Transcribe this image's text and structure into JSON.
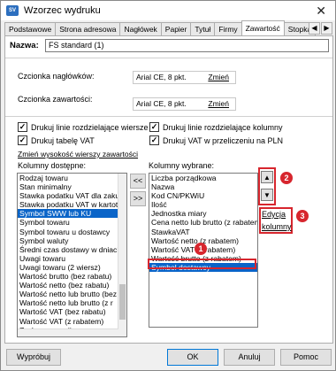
{
  "window": {
    "app_icon": "SV",
    "title": "Wzorzec wydruku",
    "close_glyph": "✕"
  },
  "tabs": [
    "Podstawowe",
    "Strona adresowa",
    "Nagłówek",
    "Papier",
    "Tytuł",
    "Firmy",
    "Zawartość",
    "Stopka"
  ],
  "active_tab": "Zawartość",
  "tab_scroll": {
    "left": "◀",
    "right": "▶"
  },
  "name": {
    "label": "Nazwa:",
    "value": "FS standard (1)"
  },
  "fonts": {
    "header_label": "Czcionka nagłówków:",
    "header_value": "Arial CE, 8 pkt.",
    "header_change": "Zmień",
    "content_label": "Czcionka zawartości:",
    "content_value": "Arial CE, 8 pkt.",
    "content_change": "Zmień"
  },
  "checkboxes": {
    "row_lines": "Drukuj linie rozdzielające wiersze",
    "col_lines": "Drukuj linie rozdzielające kolumny",
    "vat_table": "Drukuj tabelę VAT",
    "vat_pln": "Drukuj VAT w przeliczeniu na PLN",
    "check_mark": "✓"
  },
  "row_height_link": "Zmień wysokość wierszy zawartości",
  "available": {
    "label": "Kolumny dostępne:",
    "items": [
      "Rodzaj towaru",
      "Stan minimalny",
      "Stawka podatku VAT dla zaku",
      "Stawka podatku VAT w kartot",
      "Symbol SWW lub KU",
      "Symbol towaru",
      "Symbol towaru u dostawcy",
      "Symbol waluty",
      "Średni czas dostawy w dniach",
      "Uwagi towaru",
      "Uwagi towaru (2 wiersz)",
      "Wartość brutto (bez rabatu)",
      "Wartość netto (bez rabatu)",
      "Wartość netto lub brutto (bez",
      "Wartość netto lub brutto (z r",
      "Wartość VAT (bez rabatu)",
      "Wartość VAT (z rabatem)",
      "Zysk na pozycji"
    ],
    "selected": "Symbol SWW lub KU"
  },
  "move_buttons": {
    "left": "<<",
    "right": ">>"
  },
  "chosen": {
    "label": "Kolumny wybrane:",
    "items": [
      "Liczba porządkowa",
      "Nazwa",
      "Kod CN/PKWiU",
      "Ilość",
      "Jednostka miary",
      "Cena netto lub brutto (z rabatem",
      "StawkaVAT",
      "Wartość netto (z rabatem)",
      "Wartość VAT (z rabatem)",
      "Wartość brutto (z rabatem)",
      "Symbol dostawcy"
    ],
    "selected": "Symbol dostawcy"
  },
  "order_buttons": {
    "up": "▲",
    "down": "▼"
  },
  "edit_link": {
    "line1": "Edycja",
    "line2": "kolumny"
  },
  "markers": [
    "1",
    "2",
    "3"
  ],
  "footer": {
    "print": "Wypróbuj",
    "ok": "OK",
    "cancel": "Anuluj",
    "help": "Pomoc"
  },
  "colors": {
    "accent": "#0a64c8",
    "marker": "#d7262e"
  }
}
